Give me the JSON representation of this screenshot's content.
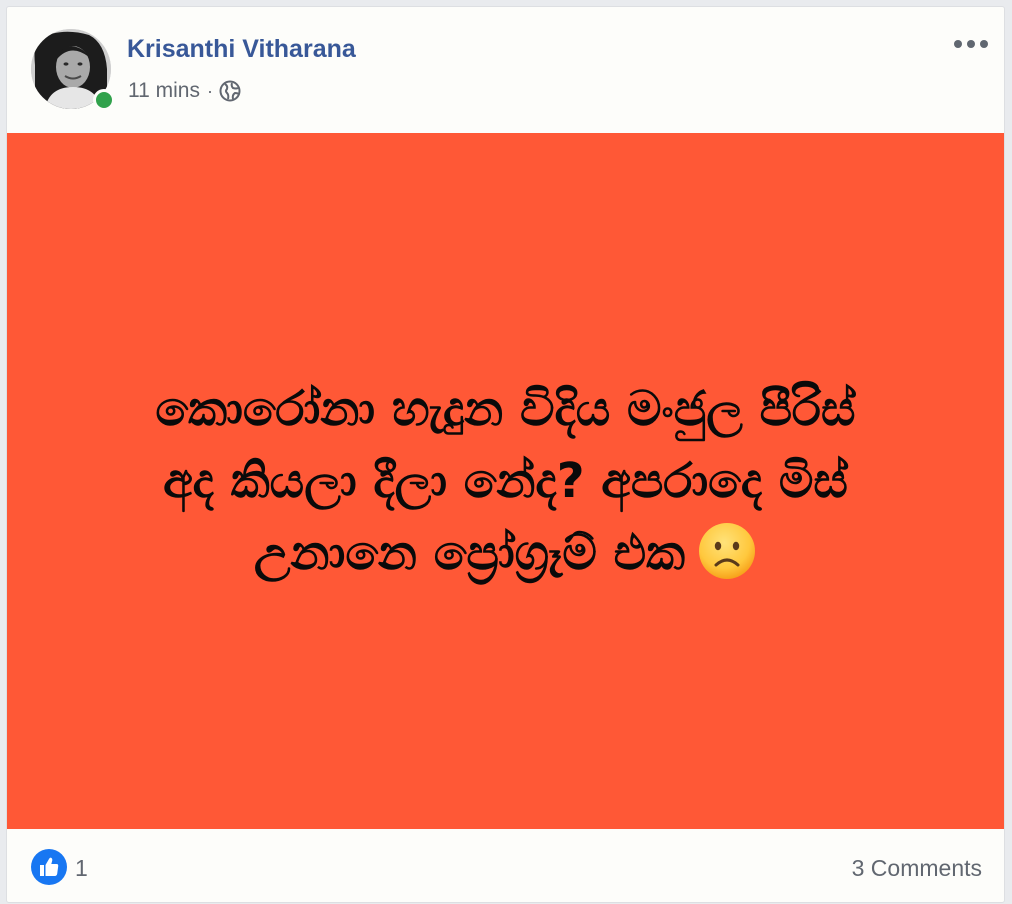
{
  "post": {
    "author": "Krisanthi Vitharana",
    "time": "11 mins",
    "separator": "·",
    "privacy_icon": "globe-icon",
    "online_status": "online",
    "background_color": "#ff5836",
    "text_lines": [
      "කොරෝනා හැදුන විදිය මංජුල පීරිස්",
      "අද කියලා දීලා නේද? අපරාදෙ මිස්",
      "උනානෙ ප්‍රෝග්‍රෑම් එක"
    ],
    "emoji": "slightly-frowning-face"
  },
  "footer": {
    "like_count": "1",
    "comments_label": "3 Comments"
  },
  "colors": {
    "author_link": "#385898",
    "meta_text": "#616770",
    "like_blue": "#1877f2",
    "online_green": "#31a24c"
  }
}
